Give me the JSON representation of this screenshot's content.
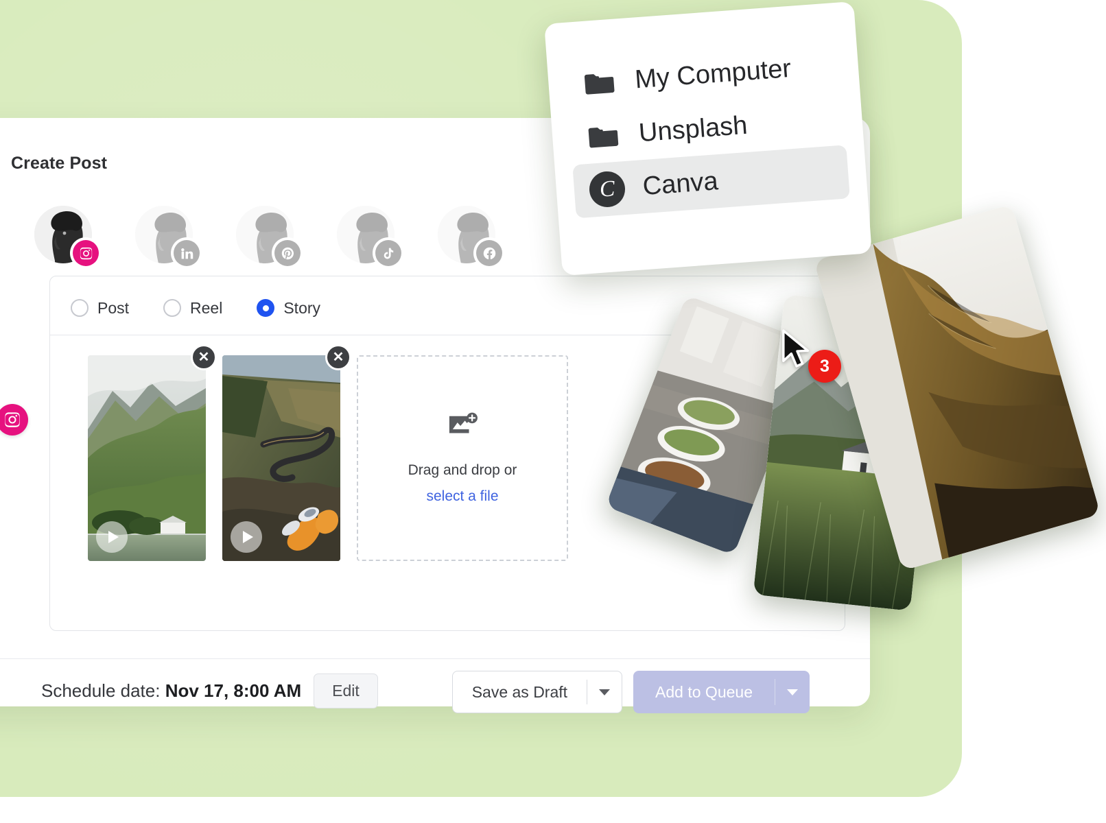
{
  "theme": {
    "background_green": "#d8ebbc",
    "accent_instagram": "#e6117f",
    "accent_blue": "#1f53f0",
    "link_blue": "#3f63e0",
    "badge_red": "#ec1c17",
    "queue_button": "#bcc0e4"
  },
  "composer": {
    "title": "Create Post",
    "accounts": [
      {
        "network": "instagram",
        "icon": "instagram-icon",
        "active": true
      },
      {
        "network": "linkedin",
        "icon": "linkedin-icon",
        "active": false
      },
      {
        "network": "pinterest",
        "icon": "pinterest-icon",
        "active": false
      },
      {
        "network": "tiktok",
        "icon": "tiktok-icon",
        "active": false
      },
      {
        "network": "facebook",
        "icon": "facebook-icon",
        "active": false
      }
    ],
    "active_channel_icon": "instagram-icon",
    "post_types": [
      {
        "label": "Post",
        "selected": false
      },
      {
        "label": "Reel",
        "selected": false
      },
      {
        "label": "Story",
        "selected": true
      }
    ],
    "media": [
      {
        "alt": "green mountain valley video",
        "type": "video",
        "remove_label": "✕"
      },
      {
        "alt": "winding mountain road video",
        "type": "video",
        "remove_label": "✕"
      }
    ],
    "dropzone": {
      "icon": "image-plus-icon",
      "text": "Drag and drop or",
      "link": "select a file"
    },
    "footer": {
      "schedule_prefix": "Schedule date:",
      "schedule_value": "Nov 17, 8:00 AM",
      "edit_label": "Edit",
      "draft_label": "Save as Draft",
      "queue_label": "Add to Queue",
      "caret_icon": "chevron-down-icon"
    }
  },
  "source_menu": {
    "items": [
      {
        "label": "My Computer",
        "icon": "folder-icon",
        "selected": false
      },
      {
        "label": "Unsplash",
        "icon": "folder-icon",
        "selected": false
      },
      {
        "label": "Canva",
        "icon": "canva-icon",
        "selected": true
      }
    ]
  },
  "drag": {
    "count": "3",
    "cursor_icon": "mouse-pointer-icon",
    "cards": [
      {
        "alt": "bowls of food on table"
      },
      {
        "alt": "white cottage in grass field"
      },
      {
        "alt": "golden mountain cliff at sunset"
      }
    ]
  }
}
